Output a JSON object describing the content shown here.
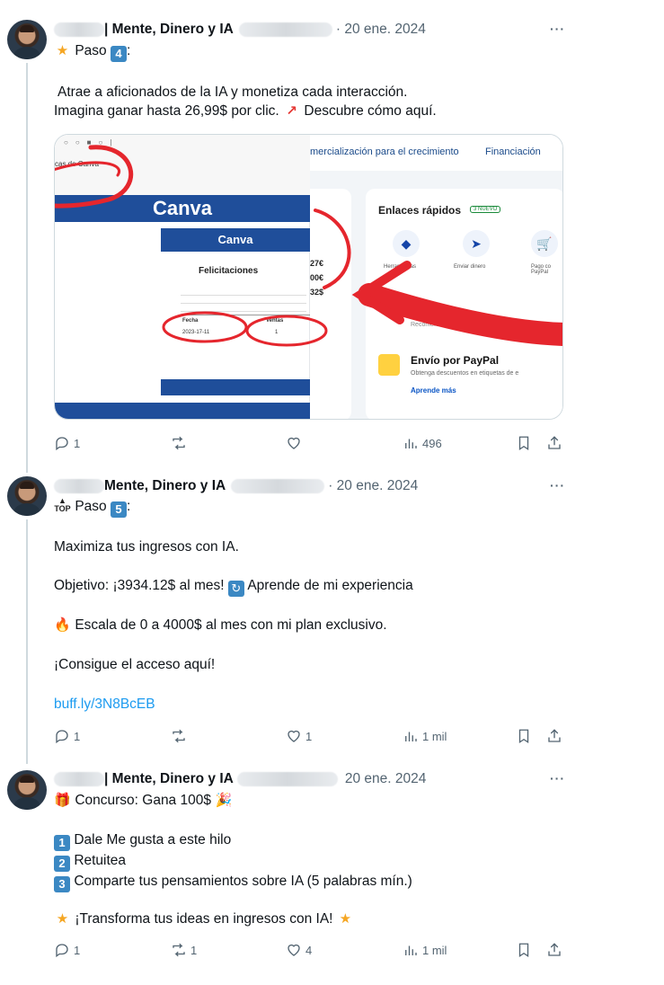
{
  "tweets": [
    {
      "author": "| Mente, Dinero y IA",
      "date": "· 20 ene. 2024",
      "more": "···",
      "step_label": "Paso",
      "step_num": "4",
      "step_suffix": ":",
      "body": {
        "line1": "Atrae a aficionados de la IA y monetiza cada interacción.",
        "line2": "Imagina ganar hasta 26,99$ por clic.",
        "line2_end": "Descubre cómo aquí."
      },
      "media": {
        "doc": {
          "tab": "cas de Canva",
          "banner": "Canva",
          "banner2": "Canva",
          "congrats": "Felicitaciones",
          "col_fecha": "Fecha",
          "col_ventas": "Ventas",
          "row_fecha": "2023-17-11",
          "row_ventas": "1"
        },
        "paypal": {
          "nav1": "mercialización para el crecimiento",
          "nav2": "Financiación",
          "quick_title": "Enlaces rápidos",
          "new_badge": "3 NUEVO",
          "q1": "Herramientas",
          "q2": "Enviar dinero",
          "q3": "Pago co PayPal",
          "amounts": [
            "27€",
            "00€",
            "32$"
          ],
          "rec": "Recomend",
          "send_title": "Envío por PayPal",
          "send_sub": "Obtenga descuentos en etiquetas de e",
          "learn": "Aprende más"
        }
      },
      "stats": {
        "replies": "1",
        "reposts": "",
        "likes": "",
        "views": "496"
      }
    },
    {
      "author": "Mente, Dinero y IA",
      "date": "· 20 ene. 2024",
      "more": "···",
      "step_label": "Paso",
      "step_num": "5",
      "step_suffix": ":",
      "body": {
        "p1": "Maximiza tus ingresos con IA.",
        "p2a": "Objetivo: ¡3934.12$ al mes!",
        "p2b": "Aprende de mi experiencia",
        "p3": "Escala de 0 a 4000$ al mes con mi plan exclusivo.",
        "p4": "¡Consigue el acceso aquí!",
        "link": "buff.ly/3N8BcEB"
      },
      "stats": {
        "replies": "1",
        "reposts": "",
        "likes": "1",
        "views": "1 mil"
      }
    },
    {
      "author": "| Mente, Dinero y IA",
      "date": "20 ene. 2024",
      "more": "···",
      "body": {
        "title": "Concurso: Gana 100$",
        "items": [
          {
            "num": "1",
            "text": "Dale Me gusta a este hilo"
          },
          {
            "num": "2",
            "text": "Retuitea"
          },
          {
            "num": "3",
            "text": "Comparte tus pensamientos sobre IA (5 palabras mín.)"
          }
        ],
        "closing": "¡Transforma tus ideas en ingresos con IA!"
      },
      "stats": {
        "replies": "1",
        "reposts": "1",
        "likes": "4",
        "views": "1 mil"
      }
    }
  ],
  "icons": {
    "reply": "reply-icon",
    "repost": "repost-icon",
    "like": "heart-icon",
    "views": "views-icon",
    "bookmark": "bookmark-icon",
    "share": "share-icon"
  },
  "colors": {
    "link": "#1d9bf0",
    "muted": "#536471",
    "keycap": "#3b88c3",
    "marker": "#e5262d",
    "canva": "#1f4e9a"
  }
}
